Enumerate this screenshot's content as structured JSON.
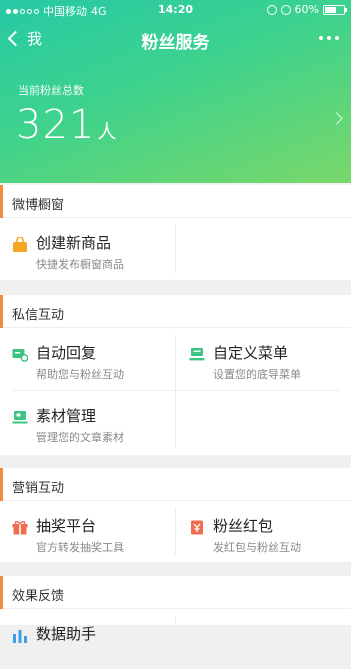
{
  "status_bar": {
    "carrier": "中国移动",
    "network": "4G",
    "time": "14:20",
    "battery": "60%"
  },
  "nav": {
    "back_label": "我",
    "title": "粉丝服务"
  },
  "fans": {
    "label": "当前粉丝总数",
    "count": "321",
    "unit": "人"
  },
  "sections": [
    {
      "title": "微博橱窗",
      "items": [
        {
          "title": "创建新商品",
          "desc": "快捷发布橱窗商品",
          "icon": "shopping-bag-icon"
        }
      ]
    },
    {
      "title": "私信互动",
      "items": [
        {
          "title": "自动回复",
          "desc": "帮助您与粉丝互动",
          "icon": "auto-reply-icon"
        },
        {
          "title": "自定义菜单",
          "desc": "设置您的底导菜单",
          "icon": "custom-menu-icon"
        },
        {
          "title": "素材管理",
          "desc": "管理您的文章素材",
          "icon": "material-icon"
        }
      ]
    },
    {
      "title": "营销互动",
      "items": [
        {
          "title": "抽奖平台",
          "desc": "官方转发抽奖工具",
          "icon": "gift-icon"
        },
        {
          "title": "粉丝红包",
          "desc": "发红包与粉丝互动",
          "icon": "red-envelope-icon"
        }
      ]
    },
    {
      "title": "效果反馈",
      "items": [
        {
          "title": "数据助手",
          "icon": "data-chart-icon"
        }
      ]
    }
  ],
  "colors": {
    "hero_start": "#26c9a6",
    "hero_end": "#7ad86a",
    "section_accent": "#f08a3c",
    "icon_orange": "#f5a623",
    "icon_green": "#3cc480",
    "icon_red": "#f26c4f",
    "icon_blue": "#3aa0e8"
  }
}
